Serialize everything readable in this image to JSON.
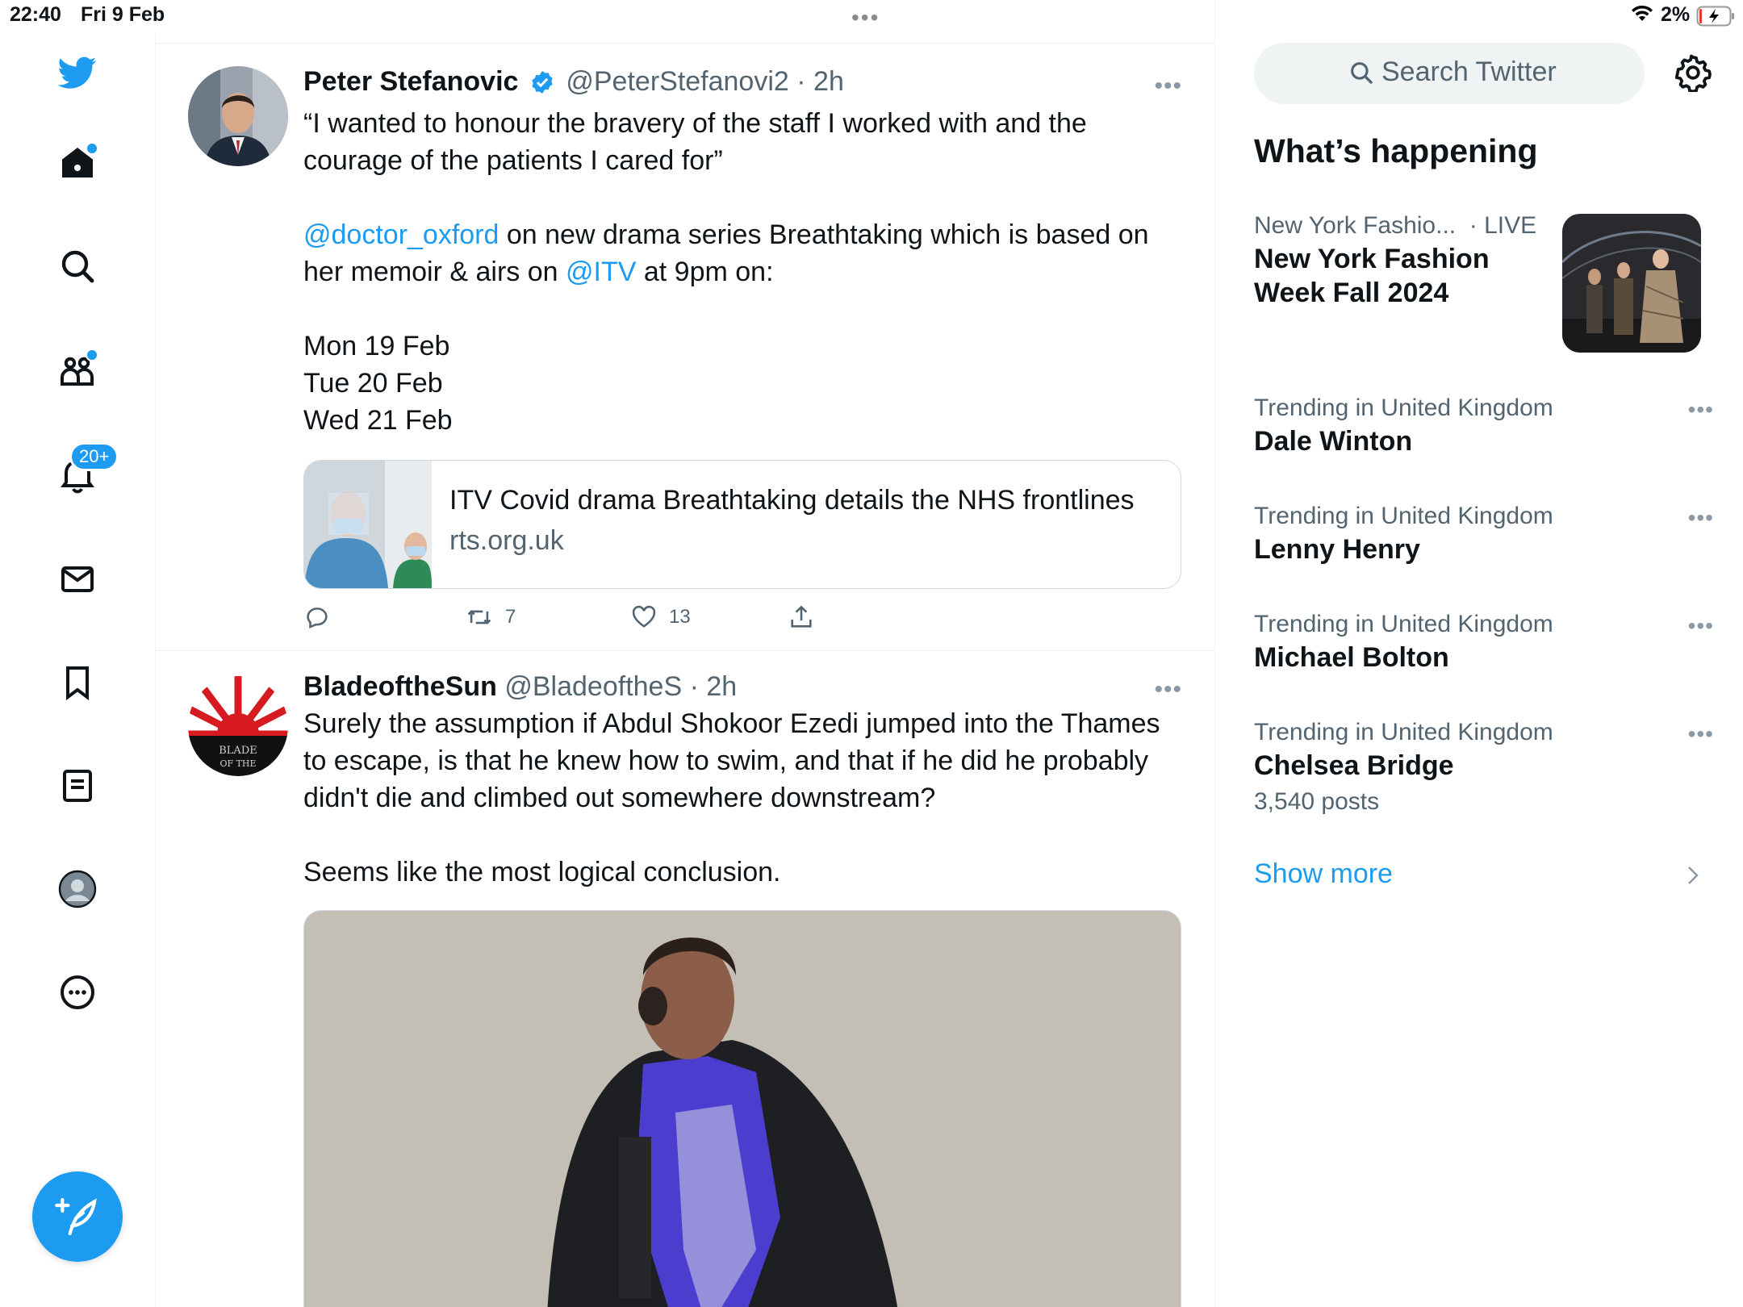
{
  "status_bar": {
    "time": "22:40",
    "date": "Fri 9 Feb",
    "battery_pct": "2%"
  },
  "nav": {
    "items": [
      {
        "name": "home",
        "icon": "home-icon",
        "has_dot": true
      },
      {
        "name": "explore",
        "icon": "search-icon"
      },
      {
        "name": "communities",
        "icon": "communities-icon",
        "has_dot": true
      },
      {
        "name": "notifications",
        "icon": "bell-icon",
        "badge": "20+"
      },
      {
        "name": "messages",
        "icon": "mail-icon"
      },
      {
        "name": "bookmarks",
        "icon": "bookmark-icon"
      },
      {
        "name": "lists",
        "icon": "list-icon"
      },
      {
        "name": "profile",
        "icon": "profile-icon"
      },
      {
        "name": "more",
        "icon": "more-circle-icon"
      }
    ],
    "notifications_badge": "20+"
  },
  "tweets": [
    {
      "name": "Peter Stefanovic",
      "handle": "@PeterStefanovi2",
      "time": "· 2h",
      "verified": true,
      "text_1": "“I wanted to honour the bravery of the staff I worked with and the courage of the patients I cared for”",
      "mention_1": "@doctor_oxford",
      "text_2": " on new drama series Breathtaking which is based on her memoir & airs on ",
      "mention_2": "@ITV",
      "text_3": " at 9pm on:",
      "dates": [
        "Mon 19 Feb",
        "Tue 20 Feb",
        "Wed 21 Feb"
      ],
      "card": {
        "title": "ITV Covid drama Breathtaking details the NHS frontlines",
        "domain": "rts.org.uk"
      },
      "retweets": "7",
      "likes": "13"
    },
    {
      "name": "BladeoftheSun",
      "handle": "@BladeoftheS",
      "time": "· 2h",
      "text_1": "Surely the assumption if Abdul Shokoor Ezedi jumped into the Thames to escape, is that he knew how to swim, and that if he did he probably didn't die and climbed out somewhere downstream?",
      "text_2": "Seems like the most logical conclusion.",
      "avatar_text": "BLADE OF THE SUN"
    }
  ],
  "sidebar": {
    "search_placeholder": "Search Twitter",
    "whats_happening": "What’s happening",
    "featured": {
      "context": "New York Fashio...",
      "live": "· LIVE",
      "title": "New York Fashion Week Fall 2024"
    },
    "trends": [
      {
        "context": "Trending in United Kingdom",
        "name": "Dale Winton"
      },
      {
        "context": "Trending in United Kingdom",
        "name": "Lenny Henry"
      },
      {
        "context": "Trending in United Kingdom",
        "name": "Michael Bolton"
      },
      {
        "context": "Trending in United Kingdom",
        "name": "Chelsea Bridge",
        "count": "3,540 posts"
      }
    ],
    "show_more": "Show more"
  },
  "colors": {
    "accent": "#1d9bf0",
    "text": "#0f1419",
    "secondary": "#536471"
  }
}
